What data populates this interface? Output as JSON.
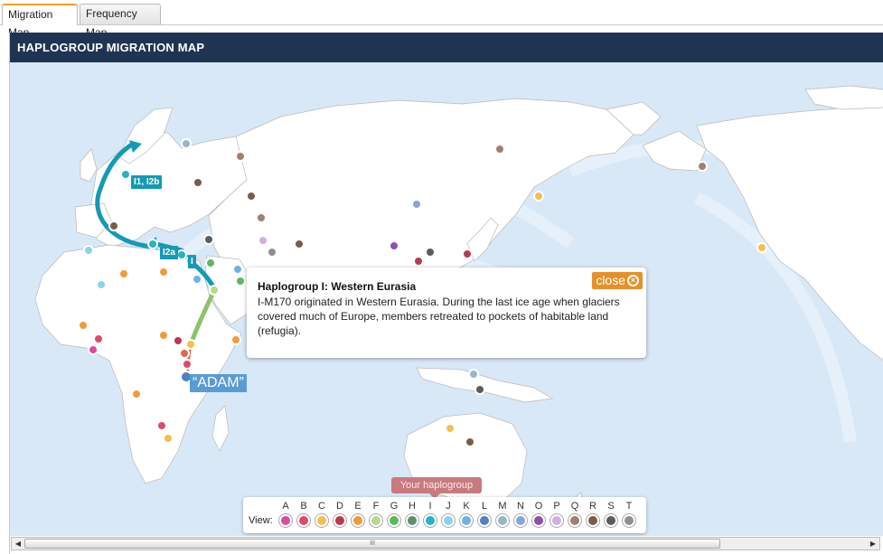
{
  "tabs": [
    {
      "label": "Migration Map",
      "active": true
    },
    {
      "label": "Frequency Map",
      "active": false
    }
  ],
  "header": {
    "title": "HAPLOGROUP MIGRATION MAP"
  },
  "map": {
    "route_labels": {
      "i1": "I1, I2b",
      "i2a": "I2a",
      "i": "I"
    },
    "adam_label": "“ADAM”"
  },
  "popup": {
    "title": "Haplogroup I: Western Eurasia",
    "body": "I-M170 originated in Western Eurasia. During the last ice age when glaciers covered much of Europe, members retreated to pockets of habitable land (refugia).",
    "close_label": "close"
  },
  "legend": {
    "your_haplogroup_label": "Your haplogroup",
    "view_label": "View:",
    "selected": "I",
    "haplogroups": [
      {
        "letter": "A",
        "color": "#d94f9b"
      },
      {
        "letter": "B",
        "color": "#dd4b6a"
      },
      {
        "letter": "C",
        "color": "#f3c04a"
      },
      {
        "letter": "D",
        "color": "#b63a52"
      },
      {
        "letter": "E",
        "color": "#f29a3a"
      },
      {
        "letter": "F",
        "color": "#b6d98b"
      },
      {
        "letter": "G",
        "color": "#5db760"
      },
      {
        "letter": "H",
        "color": "#5d8f6a"
      },
      {
        "letter": "I",
        "color": "#26b2c7"
      },
      {
        "letter": "J",
        "color": "#8dd2ec"
      },
      {
        "letter": "K",
        "color": "#6fb2e4"
      },
      {
        "letter": "L",
        "color": "#4f82c0"
      },
      {
        "letter": "M",
        "color": "#98b6c9"
      },
      {
        "letter": "N",
        "color": "#8aa4d8"
      },
      {
        "letter": "O",
        "color": "#8b4fb0"
      },
      {
        "letter": "P",
        "color": "#d3aee0"
      },
      {
        "letter": "Q",
        "color": "#a08070"
      },
      {
        "letter": "R",
        "color": "#7a5c4b"
      },
      {
        "letter": "S",
        "color": "#5c5c5c"
      },
      {
        "letter": "T",
        "color": "#8f8f8f"
      }
    ]
  },
  "scrollbar": {
    "thumb_grip": "III"
  }
}
